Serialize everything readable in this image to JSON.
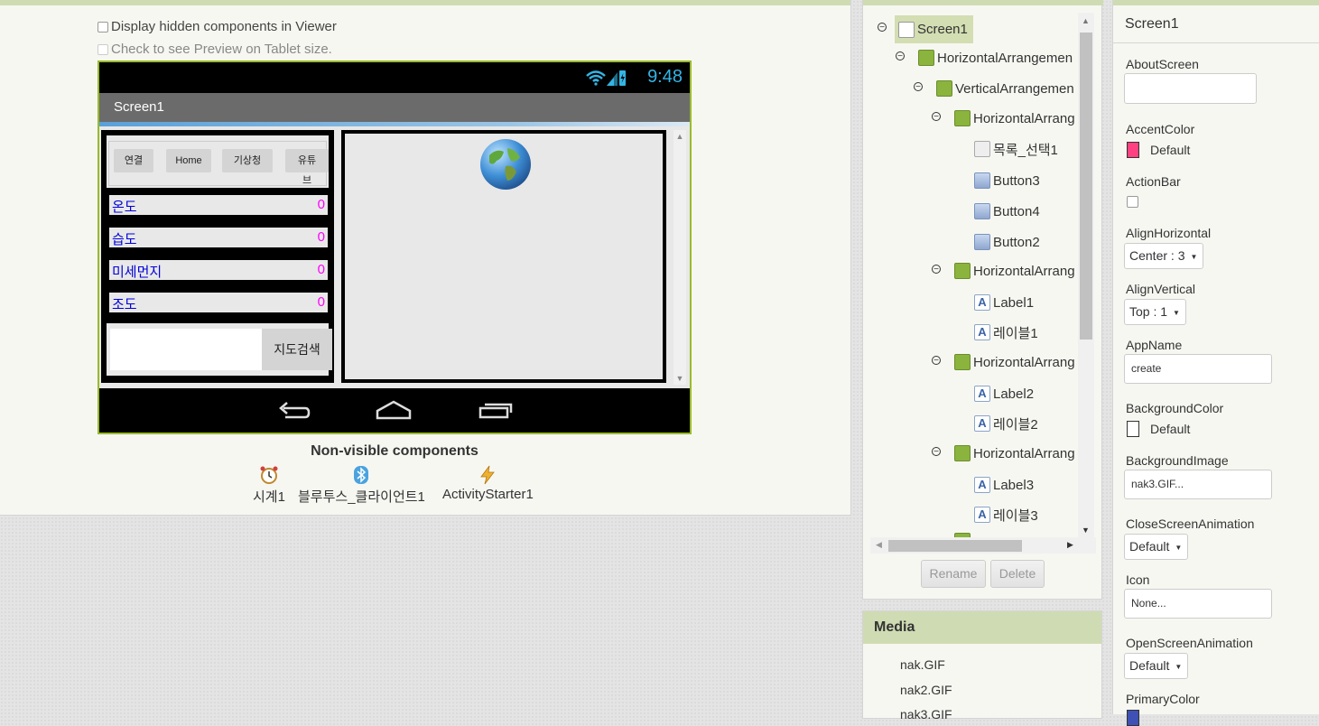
{
  "viewer": {
    "display_hidden_label": "Display hidden components in Viewer",
    "tablet_preview_label": "Check to see Preview on Tablet size.",
    "phone": {
      "status_time": "9:48",
      "screen_title": "Screen1",
      "buttons": [
        "연결",
        "Home",
        "기상청",
        "유튜",
        "브"
      ],
      "sensors": [
        {
          "label": "온도",
          "value": "0"
        },
        {
          "label": "습도",
          "value": "0"
        },
        {
          "label": "미세먼지",
          "value": "0"
        },
        {
          "label": "조도",
          "value": "0"
        }
      ],
      "search_button": "지도검색"
    },
    "nonvisible_title": "Non-visible components",
    "nonvisible": [
      {
        "name": "시계1",
        "icon": "alarm-clock-icon"
      },
      {
        "name": "블루투스_클라이언트1",
        "icon": "bluetooth-icon"
      },
      {
        "name": "ActivityStarter1",
        "icon": "lightning-icon"
      }
    ]
  },
  "tree": {
    "nodes": [
      {
        "label": "Screen1",
        "icon": "screen-icon"
      },
      {
        "label": "HorizontalArrangemen",
        "icon": "horizontal-arrangement-icon"
      },
      {
        "label": "VerticalArrangemen",
        "icon": "vertical-arrangement-icon"
      },
      {
        "label": "HorizontalArrang",
        "icon": "horizontal-arrangement-icon"
      },
      {
        "label": "목록_선택1",
        "icon": "list-picker-icon"
      },
      {
        "label": "Button3",
        "icon": "button-icon"
      },
      {
        "label": "Button4",
        "icon": "button-icon"
      },
      {
        "label": "Button2",
        "icon": "button-icon"
      },
      {
        "label": "HorizontalArrang",
        "icon": "horizontal-arrangement-icon"
      },
      {
        "label": "Label1",
        "icon": "label-icon"
      },
      {
        "label": "레이블1",
        "icon": "label-icon"
      },
      {
        "label": "HorizontalArrang",
        "icon": "horizontal-arrangement-icon"
      },
      {
        "label": "Label2",
        "icon": "label-icon"
      },
      {
        "label": "레이블2",
        "icon": "label-icon"
      },
      {
        "label": "HorizontalArrang",
        "icon": "horizontal-arrangement-icon"
      },
      {
        "label": "Label3",
        "icon": "label-icon"
      },
      {
        "label": "레이블3",
        "icon": "label-icon"
      }
    ],
    "rename_button": "Rename",
    "delete_button": "Delete"
  },
  "media": {
    "title": "Media",
    "files": [
      "nak.GIF",
      "nak2.GIF",
      "nak3.GIF"
    ]
  },
  "properties": {
    "title": "Screen1",
    "about_screen": {
      "label": "AboutScreen",
      "value": ""
    },
    "accent_color": {
      "label": "AccentColor",
      "value": "Default",
      "swatch": "#ff4081"
    },
    "action_bar": {
      "label": "ActionBar"
    },
    "align_horizontal": {
      "label": "AlignHorizontal",
      "value": "Center : 3"
    },
    "align_vertical": {
      "label": "AlignVertical",
      "value": "Top : 1"
    },
    "app_name": {
      "label": "AppName",
      "value": "create"
    },
    "background_color": {
      "label": "BackgroundColor",
      "value": "Default",
      "swatch": "#ffffff"
    },
    "background_image": {
      "label": "BackgroundImage",
      "value": "nak3.GIF..."
    },
    "close_screen_animation": {
      "label": "CloseScreenAnimation",
      "value": "Default"
    },
    "icon": {
      "label": "Icon",
      "value": "None..."
    },
    "open_screen_animation": {
      "label": "OpenScreenAnimation",
      "value": "Default"
    },
    "primary_color": {
      "label": "PrimaryColor",
      "swatch": "#3f51b5"
    }
  },
  "colors": {
    "panel_header": "#cfdcb3",
    "phone_border": "#99bb2b",
    "sensor_label": "#0000dd",
    "sensor_value": "#ff00ff",
    "status_time": "#33b5e5"
  }
}
